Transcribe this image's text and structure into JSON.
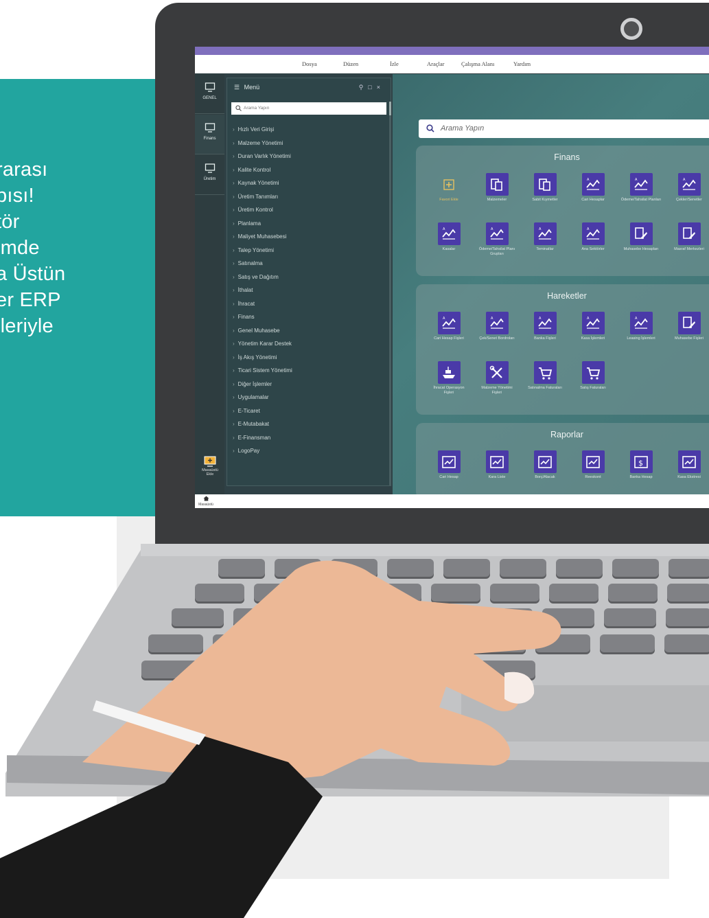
{
  "promo_text": {
    "lines": [
      "rarası",
      "pısı!",
      "tör",
      "imde",
      "a Üstün",
      "er ERP",
      "lleriyle"
    ]
  },
  "menubar": {
    "items": [
      "Dosya",
      "Düzen",
      "İzle",
      "Araçlar",
      "Çalışma Alanı",
      "Yardım"
    ]
  },
  "leftnav": {
    "items": [
      "GENEL",
      "Finans",
      "Üretim"
    ],
    "add_label": "Masaüstü Ekle"
  },
  "taskbar": {
    "home_label": "Masaüstü"
  },
  "menu_panel": {
    "title": "Menü",
    "search_placeholder": "Arama Yapın",
    "items": [
      "Hızlı Veri Girişi",
      "Malzeme Yönetimi",
      "Duran Varlık Yönetimi",
      "Kalite Kontrol",
      "Kaynak Yönetimi",
      "Üretim Tanımları",
      "Üretim Kontrol",
      "Planlama",
      "Maliyet Muhasebesi",
      "Talep Yönetimi",
      "Satınalma",
      "Satış ve Dağıtım",
      "İthalat",
      "İhracat",
      "Finans",
      "Genel Muhasebe",
      "Yönetim Karar Destek",
      "İş Akış Yönetimi",
      "Ticari Sistem Yönetimi",
      "Diğer İşlemler",
      "Uygulamalar",
      "E-Ticaret",
      "E-Mutabakat",
      "E-Finansman",
      "LogoPay"
    ]
  },
  "desktop": {
    "search_placeholder": "Arama Yapın",
    "panels": [
      {
        "title": "Finans",
        "tiles": [
          {
            "label": "Favori Ekle",
            "icon": "plus-icon",
            "fav": true
          },
          {
            "label": "Malzemeler",
            "icon": "docs-icon"
          },
          {
            "label": "Sabit Kıymetler",
            "icon": "docs-icon"
          },
          {
            "label": "Cari Hesaplar",
            "icon": "chart-icon"
          },
          {
            "label": "Ödeme/Tahsilat Planları",
            "icon": "chart-icon"
          },
          {
            "label": "Çekler/Senetler",
            "icon": "chart-icon"
          },
          {
            "label": "Kasalar",
            "icon": "chart-icon"
          },
          {
            "label": "Ödeme/Tahsilat Planı Grupları",
            "icon": "chart-icon"
          },
          {
            "label": "Teminatlar",
            "icon": "chart-icon"
          },
          {
            "label": "Ana Sektörler",
            "icon": "chart-icon"
          },
          {
            "label": "Muhasebe Hesapları",
            "icon": "edit-docs-icon"
          },
          {
            "label": "Masraf Merkezleri",
            "icon": "edit-docs-icon"
          }
        ]
      },
      {
        "title": "Hareketler",
        "tiles": [
          {
            "label": "Cari Hesap Fişleri",
            "icon": "chart-icon"
          },
          {
            "label": "Çek/Senet Bordroları",
            "icon": "chart-icon"
          },
          {
            "label": "Banka Fişleri",
            "icon": "chart-icon"
          },
          {
            "label": "Kasa İşlemleri",
            "icon": "chart-icon"
          },
          {
            "label": "Leasing İşlemleri",
            "icon": "chart-icon"
          },
          {
            "label": "Muhasebe Fişleri",
            "icon": "edit-docs-icon"
          },
          {
            "label": "İhracat Operasyon Fişleri",
            "icon": "ship-icon"
          },
          {
            "label": "Malzeme Yönetimi Fişleri",
            "icon": "tools-icon"
          },
          {
            "label": "Satınalma Faturaları",
            "icon": "cart-icon"
          },
          {
            "label": "Satış Faturaları",
            "icon": "cart-icon"
          }
        ]
      },
      {
        "title": "Raporlar",
        "tiles": [
          {
            "label": "Cari Hesap",
            "icon": "report-icon"
          },
          {
            "label": "Kara Liste",
            "icon": "report-icon"
          },
          {
            "label": "Borç/Alacak",
            "icon": "report-icon"
          },
          {
            "label": "Reeskont",
            "icon": "report-icon"
          },
          {
            "label": "Banka Hesap",
            "icon": "money-icon"
          },
          {
            "label": "Kasa Ekstresi",
            "icon": "report-icon"
          }
        ]
      }
    ]
  },
  "colors": {
    "teal_card": "#22a59f",
    "tile_purple": "#4a3aa8",
    "title_stripe": "#7f6fbd",
    "desktop_teal": "#477e7e"
  }
}
